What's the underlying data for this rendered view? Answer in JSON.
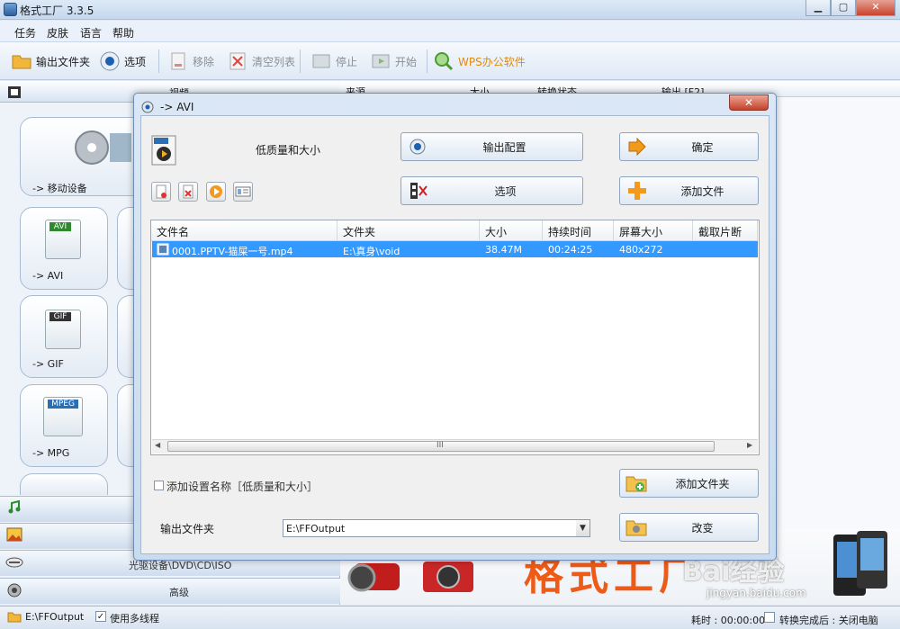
{
  "window": {
    "title": "格式工厂 3.3.5"
  },
  "menu": [
    "任务",
    "皮肤",
    "语言",
    "帮助"
  ],
  "toolbar": {
    "output_folder": "输出文件夹",
    "options": "选项",
    "remove": "移除",
    "clear_list": "清空列表",
    "stop": "停止",
    "start": "开始",
    "wps": "WPS办公软件"
  },
  "left": {
    "video_header": "视频",
    "tiles": [
      "-> 移动设备",
      "-> AVI",
      "-> GIF",
      "-> MPG"
    ],
    "tile_icons": [
      "AVI",
      "GIF",
      "MPEG"
    ],
    "categories": [
      "音频",
      "图片",
      "光驱设备\\DVD\\CD\\ISO",
      "高级"
    ]
  },
  "right_header": [
    "来源",
    "大小",
    "转换状态",
    "输出 [F2]"
  ],
  "dialog": {
    "title": "-> AVI",
    "quality_label": "低质量和大小",
    "btn_output_config": "输出配置",
    "btn_ok": "确定",
    "btn_options": "选项",
    "btn_add_file": "添加文件",
    "btn_add_folder": "添加文件夹",
    "btn_change": "改变",
    "columns": [
      "文件名",
      "文件夹",
      "大小",
      "持续时间",
      "屏幕大小",
      "截取片断"
    ],
    "rows": [
      {
        "name": "0001.PPTV-猫屎一号.mp4",
        "folder": "E:\\真身\\void",
        "size": "38.47M",
        "duration": "00:24:25",
        "screen": "480x272",
        "clip": ""
      }
    ],
    "add_setting_name": "添加设置名称［低质量和大小］",
    "output_folder_label": "输出文件夹",
    "output_folder_value": "E:\\FFOutput",
    "scroll_grip": "III"
  },
  "status": {
    "path": "E:\\FFOutput",
    "multithread": "使用多线程",
    "elapsed": "耗时 : 00:00:00",
    "after_convert": "转换完成后 : 关闭电脑"
  },
  "watermark": {
    "brand": "Bai经验",
    "url": "jingyan.baidu.com",
    "banner_text": "格式工厂"
  },
  "colors": {
    "selection": "#3399ff",
    "accent_orange": "#f39a1d",
    "close_red": "#c9432c"
  }
}
